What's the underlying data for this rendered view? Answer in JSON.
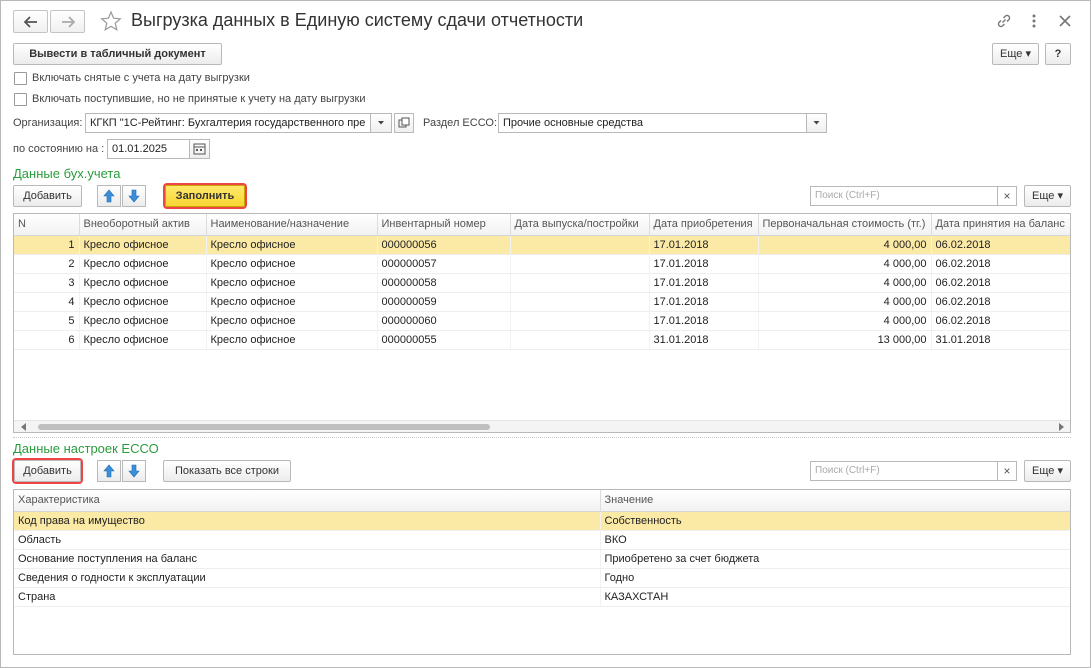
{
  "window": {
    "title": "Выгрузка данных в  Единую систему сдачи отчетности"
  },
  "toolbar": {
    "print_label": "Вывести в табличный документ",
    "more_label": "Еще ▾",
    "help_label": "?"
  },
  "options": {
    "include_removed": "Включать снятые с учета на дату выгрузки",
    "include_received": "Включать поступившие, но не принятые к учету на дату выгрузки"
  },
  "form": {
    "org_label": "Организация:",
    "org_value": "КГКП \"1С-Рейтинг: Бухгалтерия государственного пре",
    "section_label": "Раздел ЕССО:",
    "section_value": "Прочие основные средства",
    "date_label": "по состоянию на :",
    "date_value": "01.01.2025"
  },
  "accounting": {
    "title": "Данные бух.учета",
    "add_label": "Добавить",
    "fill_label": "Заполнить",
    "search_placeholder": "Поиск (Ctrl+F)",
    "more_label": "Еще ▾",
    "columns": [
      "N",
      "Внеоборотный актив",
      "Наименование/назначение",
      "Инвентарный номер",
      "Дата выпуска/постройки",
      "Дата приобретения",
      "Первоначальная стоимость (тг.)",
      "Дата принятия на баланс"
    ],
    "rows": [
      [
        "1",
        "Кресло офисное",
        "Кресло офисное",
        "000000056",
        "",
        "17.01.2018",
        "4 000,00",
        "06.02.2018"
      ],
      [
        "2",
        "Кресло офисное",
        "Кресло офисное",
        "000000057",
        "",
        "17.01.2018",
        "4 000,00",
        "06.02.2018"
      ],
      [
        "3",
        "Кресло офисное",
        "Кресло офисное",
        "000000058",
        "",
        "17.01.2018",
        "4 000,00",
        "06.02.2018"
      ],
      [
        "4",
        "Кресло офисное",
        "Кресло офисное",
        "000000059",
        "",
        "17.01.2018",
        "4 000,00",
        "06.02.2018"
      ],
      [
        "5",
        "Кресло офисное",
        "Кресло офисное",
        "000000060",
        "",
        "17.01.2018",
        "4 000,00",
        "06.02.2018"
      ],
      [
        "6",
        "Кресло офисное",
        "Кресло офисное",
        "000000055",
        "",
        "31.01.2018",
        "13 000,00",
        "31.01.2018"
      ]
    ]
  },
  "settings": {
    "title": "Данные настроек  ЕССО",
    "add_label": "Добавить",
    "show_all_label": "Показать все строки",
    "search_placeholder": "Поиск (Ctrl+F)",
    "more_label": "Еще ▾",
    "columns": [
      "Характеристика",
      "Значение"
    ],
    "rows": [
      [
        "Код права на имущество",
        "Собственность"
      ],
      [
        "Область",
        "ВКО"
      ],
      [
        "Основание поступления на баланс",
        "Приобретено за счет бюджета"
      ],
      [
        "Сведения о годности к эксплуатации",
        "Годно"
      ],
      [
        "Страна",
        "КАЗАХСТАН"
      ]
    ]
  },
  "colors": {
    "section_green": "#2a9c3c",
    "selected_row": "#fbe9a6",
    "fill_button": "#f9d633",
    "highlight_outline": "#e44"
  }
}
